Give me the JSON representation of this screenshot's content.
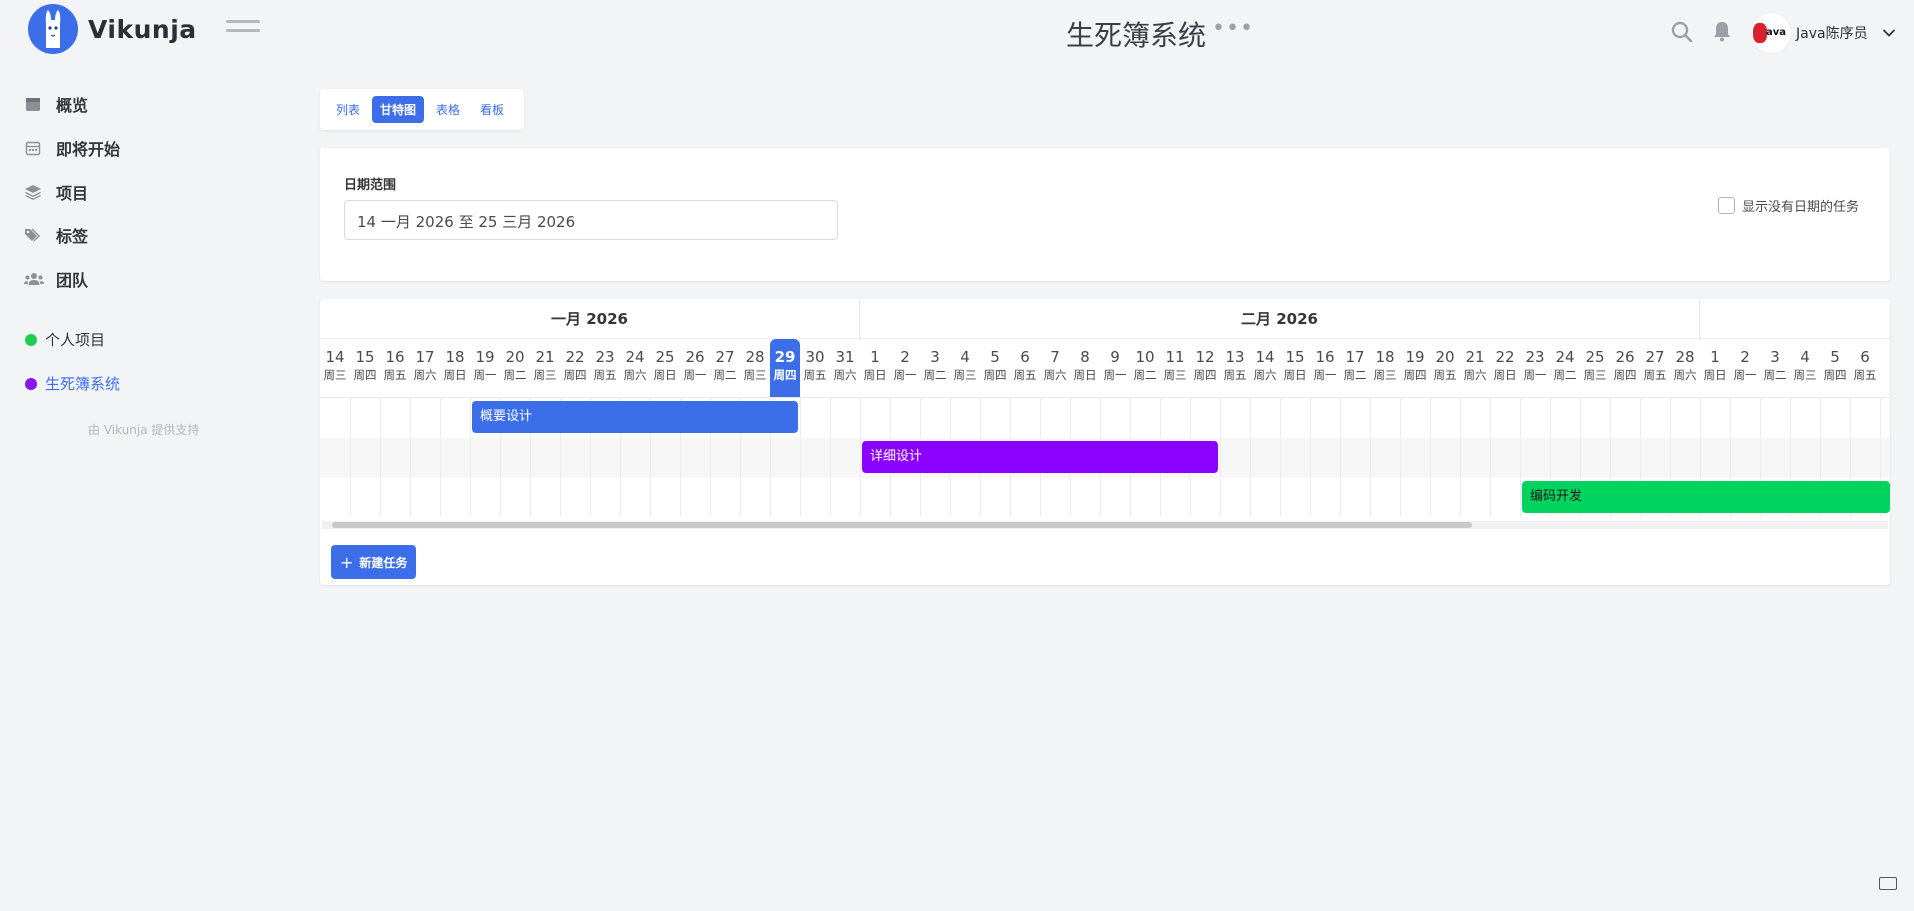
{
  "app": {
    "name": "Vikunja"
  },
  "header": {
    "project_title": "生死簿系统",
    "title_menu": "•••",
    "user_name": "Java陈序员",
    "avatar_text": "ava"
  },
  "sidebar": {
    "nav": [
      {
        "label": "概览",
        "icon": "calendar-icon"
      },
      {
        "label": "即将开始",
        "icon": "calendar-grid-icon"
      },
      {
        "label": "项目",
        "icon": "layers-icon"
      },
      {
        "label": "标签",
        "icon": "tags-icon"
      },
      {
        "label": "团队",
        "icon": "users-icon"
      }
    ],
    "projects": [
      {
        "label": "个人项目",
        "color": "#1fce4e"
      },
      {
        "label": "生死簿系统",
        "color": "#8b12f1"
      }
    ],
    "powered_by": "由 Vikunja 提供支持"
  },
  "views": [
    "列表",
    "甘特图",
    "表格",
    "看板"
  ],
  "active_view": "甘特图",
  "filter": {
    "label": "日期范围",
    "date_range": "14 一月 2026 至 25 三月 2026",
    "show_no_date": "显示没有日期的任务",
    "show_no_date_checked": false
  },
  "gantt": {
    "months": [
      "一月 2026",
      "二月 2026",
      ""
    ],
    "days": [
      {
        "d": "14",
        "w": "周三"
      },
      {
        "d": "15",
        "w": "周四"
      },
      {
        "d": "16",
        "w": "周五"
      },
      {
        "d": "17",
        "w": "周六"
      },
      {
        "d": "18",
        "w": "周日"
      },
      {
        "d": "19",
        "w": "周一"
      },
      {
        "d": "20",
        "w": "周二"
      },
      {
        "d": "21",
        "w": "周三"
      },
      {
        "d": "22",
        "w": "周四"
      },
      {
        "d": "23",
        "w": "周五"
      },
      {
        "d": "24",
        "w": "周六"
      },
      {
        "d": "25",
        "w": "周日"
      },
      {
        "d": "26",
        "w": "周一"
      },
      {
        "d": "27",
        "w": "周二"
      },
      {
        "d": "28",
        "w": "周三"
      },
      {
        "d": "29",
        "w": "周四",
        "today": true
      },
      {
        "d": "30",
        "w": "周五"
      },
      {
        "d": "31",
        "w": "周六"
      },
      {
        "d": "1",
        "w": "周日"
      },
      {
        "d": "2",
        "w": "周一"
      },
      {
        "d": "3",
        "w": "周二"
      },
      {
        "d": "4",
        "w": "周三"
      },
      {
        "d": "5",
        "w": "周四"
      },
      {
        "d": "6",
        "w": "周五"
      },
      {
        "d": "7",
        "w": "周六"
      },
      {
        "d": "8",
        "w": "周日"
      },
      {
        "d": "9",
        "w": "周一"
      },
      {
        "d": "10",
        "w": "周二"
      },
      {
        "d": "11",
        "w": "周三"
      },
      {
        "d": "12",
        "w": "周四"
      },
      {
        "d": "13",
        "w": "周五"
      },
      {
        "d": "14",
        "w": "周六"
      },
      {
        "d": "15",
        "w": "周日"
      },
      {
        "d": "16",
        "w": "周一"
      },
      {
        "d": "17",
        "w": "周二"
      },
      {
        "d": "18",
        "w": "周三"
      },
      {
        "d": "19",
        "w": "周四"
      },
      {
        "d": "20",
        "w": "周五"
      },
      {
        "d": "21",
        "w": "周六"
      },
      {
        "d": "22",
        "w": "周日"
      },
      {
        "d": "23",
        "w": "周一"
      },
      {
        "d": "24",
        "w": "周二"
      },
      {
        "d": "25",
        "w": "周三"
      },
      {
        "d": "26",
        "w": "周四"
      },
      {
        "d": "27",
        "w": "周五"
      },
      {
        "d": "28",
        "w": "周六"
      },
      {
        "d": "1",
        "w": "周日"
      },
      {
        "d": "2",
        "w": "周一"
      },
      {
        "d": "3",
        "w": "周二"
      },
      {
        "d": "4",
        "w": "周三"
      },
      {
        "d": "5",
        "w": "周四"
      },
      {
        "d": "6",
        "w": "周五"
      }
    ],
    "tasks": [
      {
        "title": "概要设计",
        "start": "2026-01-19",
        "end": "2026-01-30",
        "color": "#3b6ee8",
        "text_color": "#ffffff"
      },
      {
        "title": "详细设计",
        "start": "2026-02-01",
        "end": "2026-02-13",
        "color": "#8b02ff",
        "text_color": "#ffffff"
      },
      {
        "title": "编码开发",
        "start": "2026-02-23",
        "end": "2026-03-25",
        "color": "#00d45f",
        "text_color": "#1a1a1a"
      }
    ],
    "new_task_label": "新建任务"
  }
}
